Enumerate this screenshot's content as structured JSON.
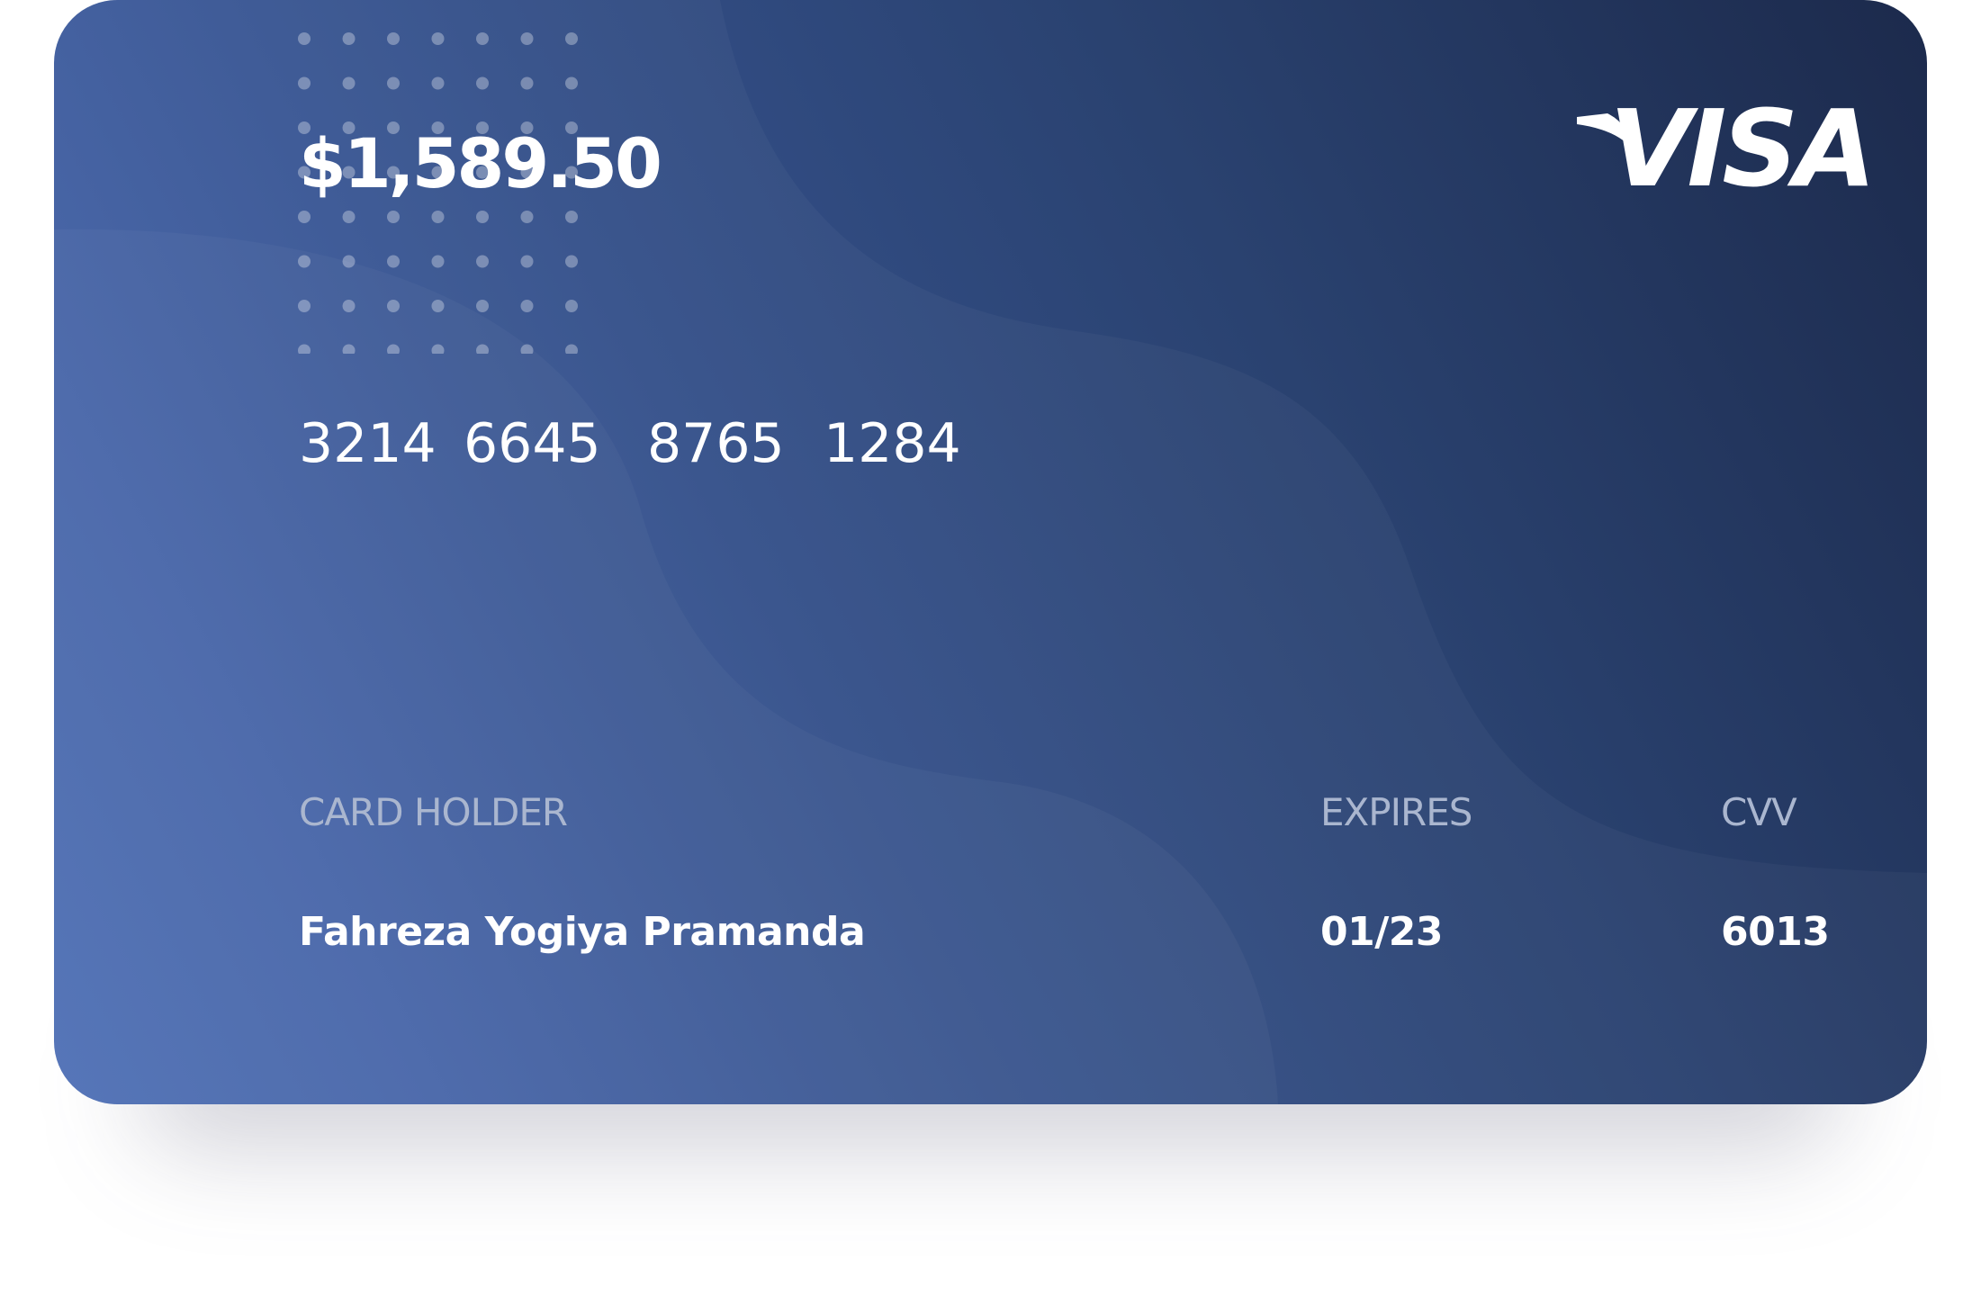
{
  "card": {
    "balance": "$1,589.50",
    "brand": "VISA",
    "number_groups": [
      "3214",
      "6645",
      "8765",
      "1284"
    ],
    "holder": {
      "label": "CARD HOLDER",
      "value": "Fahreza Yogiya Pramanda"
    },
    "expires": {
      "label": "EXPIRES",
      "value": "01/23"
    },
    "cvv": {
      "label": "CVV",
      "value": "6013"
    }
  },
  "icons": {
    "brand_logo": "visa-logo-icon",
    "decoration": "dot-grid-icon"
  },
  "colors": {
    "gradient_start": "#4a6cb5",
    "gradient_end": "#1c2a4c",
    "label_color": "#aab6cf",
    "text_color": "#ffffff"
  }
}
